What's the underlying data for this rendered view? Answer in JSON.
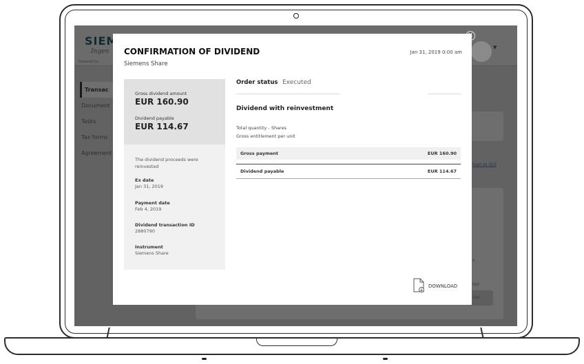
{
  "background_app": {
    "brand": "SIEM",
    "tagline": "Ingen",
    "powered_by": "Powered by",
    "nav": [
      "Transac",
      "Document",
      "Tasks",
      "Tax forms",
      "Agreement"
    ],
    "link_text": "load as XLS",
    "fragment_1": "s",
    "fragment_2": "ted",
    "fragment_3": "ted"
  },
  "modal": {
    "title": "CONFIRMATION OF DIVIDEND",
    "subtitle": "Siemens Share",
    "date": "Jan 31, 2019 0:00 am",
    "left": {
      "gross_label": "Gross dividend amount",
      "gross_value": "EUR 160.90",
      "payable_label": "Dividend payable",
      "payable_value": "EUR 114.67",
      "note": "The dividend proceeds were reinvested",
      "ex_date_label": "Ex date",
      "ex_date_value": "Jan 31, 2019",
      "payment_date_label": "Payment date",
      "payment_date_value": "Feb 4, 2019",
      "txn_id_label": "Dividend transaction ID",
      "txn_id_value": "2880790",
      "instrument_label": "Instrument",
      "instrument_value": "Siemens Share"
    },
    "right": {
      "order_status_label": "Order status",
      "order_status_value": "Executed",
      "section_title": "Dividend with reinvestment",
      "total_quantity": "Total quantity - Shares",
      "gross_entitlement": "Gross entitlement per unit",
      "gross_payment_label": "Gross payment",
      "gross_payment_value": "EUR 160.90",
      "dividend_payable_label": "Dividend payable",
      "dividend_payable_value": "EUR 114.67"
    },
    "download_label": "DOWNLOAD"
  }
}
